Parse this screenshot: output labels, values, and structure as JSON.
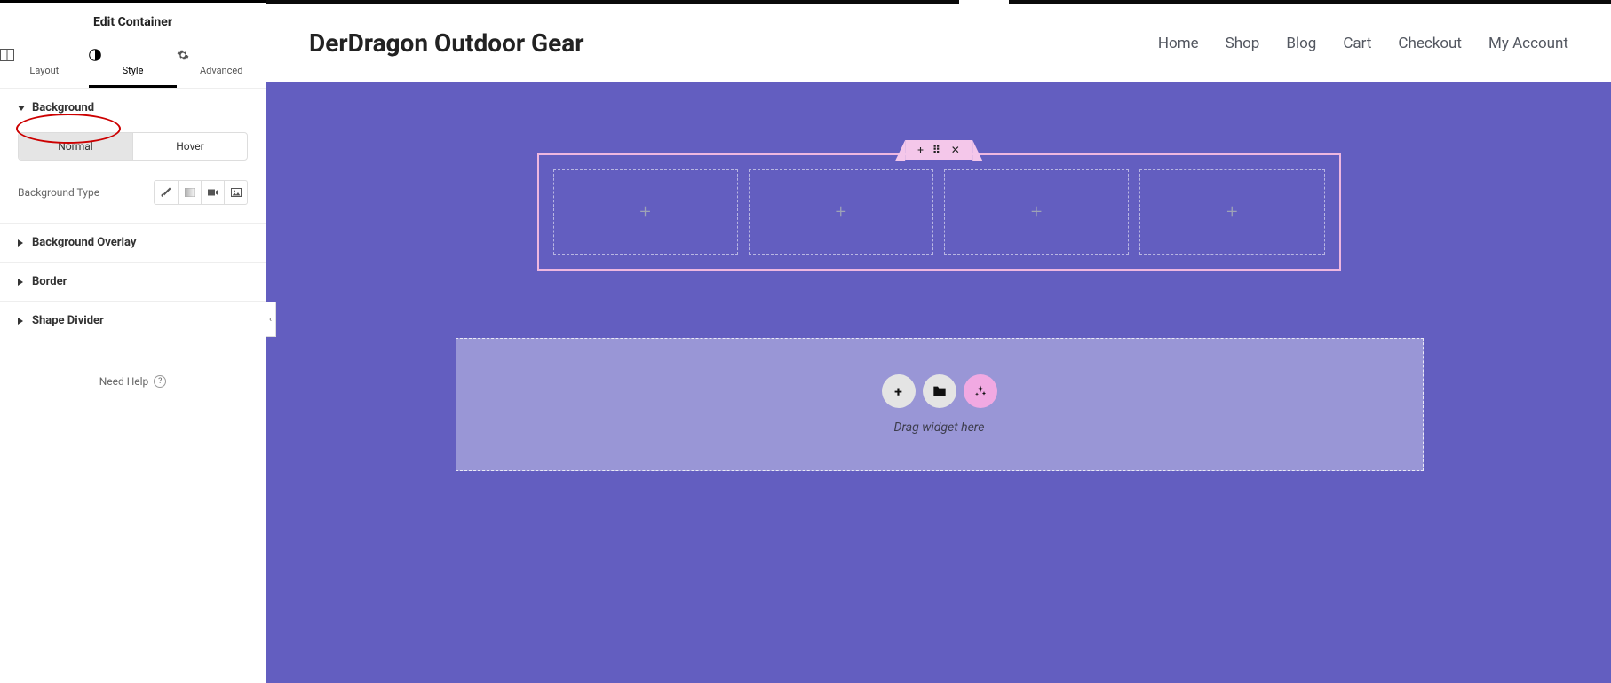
{
  "panel": {
    "title": "Edit Container"
  },
  "tabs": {
    "layout": "Layout",
    "style": "Style",
    "advanced": "Advanced"
  },
  "sections": {
    "background": {
      "title": "Background",
      "normal": "Normal",
      "hover": "Hover",
      "bg_type_label": "Background Type"
    },
    "overlay": "Background Overlay",
    "border": "Border",
    "shape": "Shape Divider"
  },
  "help": "Need Help",
  "site": {
    "brand": "DerDragon Outdoor Gear",
    "nav": [
      "Home",
      "Shop",
      "Blog",
      "Cart",
      "Checkout",
      "My Account"
    ]
  },
  "dropzone": {
    "text": "Drag widget here"
  }
}
